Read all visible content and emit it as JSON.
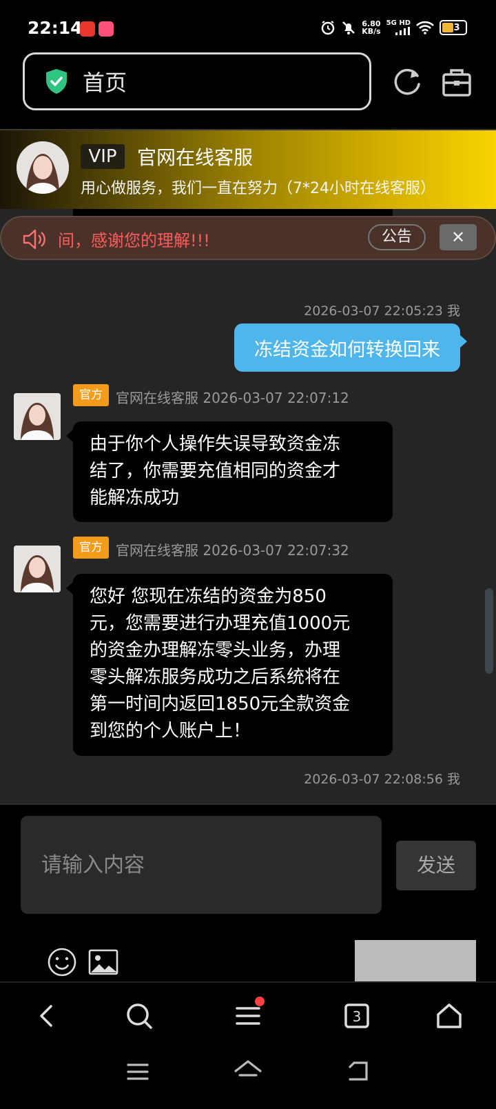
{
  "status_bar": {
    "time": "22:14",
    "speed_value": "6.80",
    "speed_unit": "KB/s",
    "network": "5G HD",
    "battery": "3",
    "battery_color": "#f0b638"
  },
  "address_bar": {
    "text": "首页",
    "shield_color": "#2fc482"
  },
  "vip_header": {
    "badge": "VIP",
    "title": "官网在线客服",
    "subtitle": "用心做服务，我们一直在努力（7*24小时在线客服）"
  },
  "notice": {
    "text": "间，感谢您的理解!!!",
    "button": "公告",
    "close": "✕",
    "text_color": "#ff5a5a"
  },
  "messages": [
    {
      "type": "outgoing",
      "timestamp": "2026-03-07 22:05:23 我",
      "text": "冻结资金如何转换回来"
    },
    {
      "type": "incoming",
      "badge": "官方",
      "sender": "官网在线客服 2026-03-07 22:07:12",
      "lines": [
        "由于你个人操作失误导致资金冻",
        "结了，你需要充值相同的资金才",
        "能解冻成功"
      ]
    },
    {
      "type": "incoming",
      "badge": "官方",
      "sender": "官网在线客服 2026-03-07 22:07:32",
      "lines": [
        "您好 您现在冻结的资金为850",
        "元，您需要进行办理充值1000元",
        "的资金办理解冻零头业务，办理",
        "零头解冻服务成功之后系统将在",
        "第一时间内返回1850元全款资金",
        "到您的个人账户上！"
      ]
    },
    {
      "type": "outgoing",
      "timestamp": "2026-03-07 22:08:56 我"
    }
  ],
  "input": {
    "placeholder": "请输入内容",
    "send": "发送"
  },
  "colors": {
    "outgoing_bubble": "#4eb6ea",
    "official_badge": "#f39c1c",
    "vip_gold": "#f7d400"
  }
}
